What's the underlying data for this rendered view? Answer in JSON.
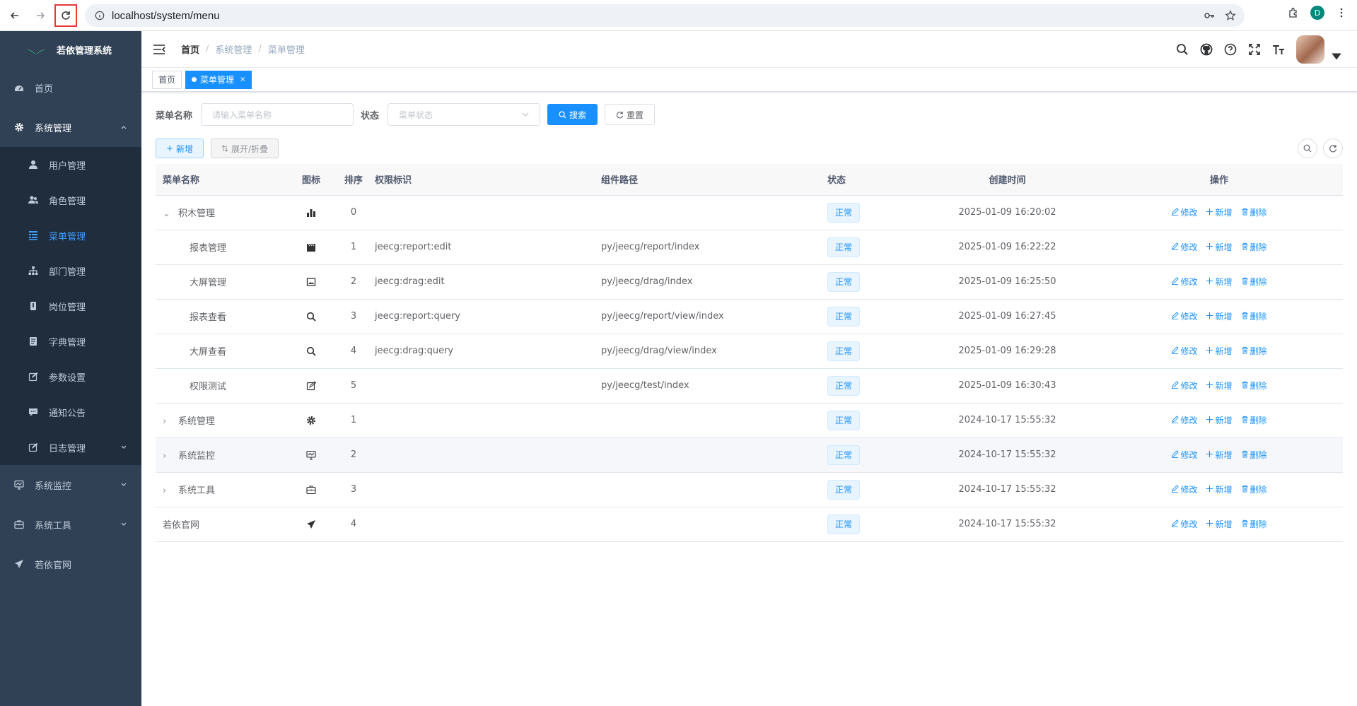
{
  "browser": {
    "url": "localhost/system/menu",
    "profile_initial": "D"
  },
  "sidebar": {
    "title": "若依管理系统",
    "items": [
      {
        "label": "首页",
        "icon": "dashboard-icon"
      },
      {
        "label": "系统管理",
        "icon": "gear-icon",
        "expanded": true,
        "children": [
          {
            "label": "用户管理",
            "icon": "user-icon"
          },
          {
            "label": "角色管理",
            "icon": "peoples-icon"
          },
          {
            "label": "菜单管理",
            "icon": "tree-table-icon",
            "active": true
          },
          {
            "label": "部门管理",
            "icon": "tree-icon"
          },
          {
            "label": "岗位管理",
            "icon": "post-icon"
          },
          {
            "label": "字典管理",
            "icon": "dict-icon"
          },
          {
            "label": "参数设置",
            "icon": "edit-icon"
          },
          {
            "label": "通知公告",
            "icon": "message-icon"
          },
          {
            "label": "日志管理",
            "icon": "log-icon"
          }
        ]
      },
      {
        "label": "系统监控",
        "icon": "monitor-icon"
      },
      {
        "label": "系统工具",
        "icon": "tool-icon"
      },
      {
        "label": "若依官网",
        "icon": "guide-icon"
      }
    ]
  },
  "breadcrumb": [
    "首页",
    "系统管理",
    "菜单管理"
  ],
  "tags": [
    {
      "label": "首页"
    },
    {
      "label": "菜单管理",
      "active": true
    }
  ],
  "search": {
    "name_label": "菜单名称",
    "name_placeholder": "请输入菜单名称",
    "status_label": "状态",
    "status_placeholder": "菜单状态",
    "search_btn": "搜索",
    "reset_btn": "重置"
  },
  "toolbar": {
    "add_btn": "新增",
    "expand_btn": "展开/折叠"
  },
  "table": {
    "headers": [
      "菜单名称",
      "图标",
      "排序",
      "权限标识",
      "组件路径",
      "状态",
      "创建时间",
      "操作"
    ],
    "ops": {
      "edit": "修改",
      "add": "新增",
      "delete": "删除"
    },
    "rows": [
      {
        "name": "积木管理",
        "level": 0,
        "expand": "open",
        "icon": "chart-icon",
        "order": "0",
        "perm": "",
        "path": "",
        "status": "正常",
        "time": "2025-01-09 16:20:02"
      },
      {
        "name": "报表管理",
        "level": 1,
        "expand": "none",
        "icon": "film-icon",
        "order": "1",
        "perm": "jeecg:report:edit",
        "path": "py/jeecg/report/index",
        "status": "正常",
        "time": "2025-01-09 16:22:22"
      },
      {
        "name": "大屏管理",
        "level": 1,
        "expand": "none",
        "icon": "picture-icon",
        "order": "2",
        "perm": "jeecg:drag:edit",
        "path": "py/jeecg/drag/index",
        "status": "正常",
        "time": "2025-01-09 16:25:50"
      },
      {
        "name": "报表查看",
        "level": 1,
        "expand": "none",
        "icon": "search-icon",
        "order": "3",
        "perm": "jeecg:report:query",
        "path": "py/jeecg/report/view/index",
        "status": "正常",
        "time": "2025-01-09 16:27:45"
      },
      {
        "name": "大屏查看",
        "level": 1,
        "expand": "none",
        "icon": "search-icon",
        "order": "4",
        "perm": "jeecg:drag:query",
        "path": "py/jeecg/drag/view/index",
        "status": "正常",
        "time": "2025-01-09 16:29:28"
      },
      {
        "name": "权限测试",
        "level": 1,
        "expand": "none",
        "icon": "edit-icon",
        "order": "5",
        "perm": "",
        "path": "py/jeecg/test/index",
        "status": "正常",
        "time": "2025-01-09 16:30:43"
      },
      {
        "name": "系统管理",
        "level": 0,
        "expand": "closed",
        "icon": "gear-icon",
        "order": "1",
        "perm": "",
        "path": "",
        "status": "正常",
        "time": "2024-10-17 15:55:32"
      },
      {
        "name": "系统监控",
        "level": 0,
        "expand": "closed",
        "icon": "monitor-icon",
        "order": "2",
        "perm": "",
        "path": "",
        "status": "正常",
        "time": "2024-10-17 15:55:32",
        "hover": true
      },
      {
        "name": "系统工具",
        "level": 0,
        "expand": "closed",
        "icon": "tool-icon",
        "order": "3",
        "perm": "",
        "path": "",
        "status": "正常",
        "time": "2024-10-17 15:55:32"
      },
      {
        "name": "若依官网",
        "level": 0,
        "expand": "leaf",
        "icon": "guide-icon",
        "order": "4",
        "perm": "",
        "path": "",
        "status": "正常",
        "time": "2024-10-17 15:55:32"
      }
    ]
  }
}
